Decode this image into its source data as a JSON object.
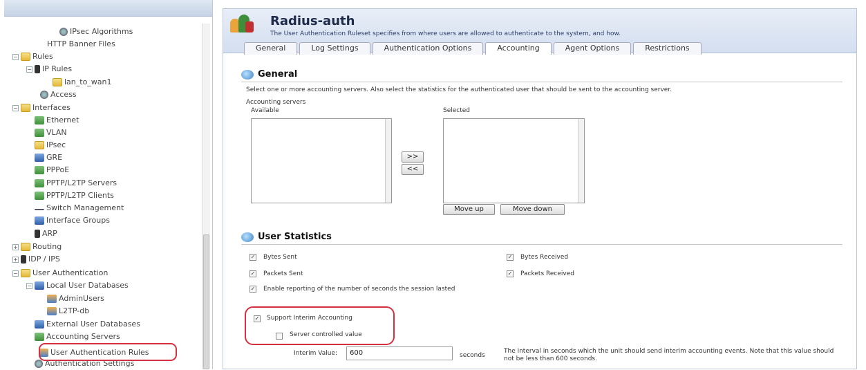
{
  "sidebar": {
    "items": [
      {
        "label": "IPsec Algorithms",
        "icon": "gear-icon"
      },
      {
        "label": "HTTP Banner Files",
        "icon": ""
      },
      {
        "label": "Rules",
        "icon": "folder-icon",
        "expander": "⊟"
      },
      {
        "label": "IP Rules",
        "icon": "rules-icon",
        "expander": "⊟"
      },
      {
        "label": "lan_to_wan1",
        "icon": "rule-icon"
      },
      {
        "label": "Access",
        "icon": "access-icon"
      },
      {
        "label": "Interfaces",
        "icon": "folder-icon",
        "expander": "⊟"
      },
      {
        "label": "Ethernet",
        "icon": "ethernet-icon"
      },
      {
        "label": "VLAN",
        "icon": "vlan-icon"
      },
      {
        "label": "IPsec",
        "icon": "ipsec-icon"
      },
      {
        "label": "GRE",
        "icon": "gre-icon"
      },
      {
        "label": "PPPoE",
        "icon": "pppoe-icon"
      },
      {
        "label": "PPTP/L2TP Servers",
        "icon": "server-icon"
      },
      {
        "label": "PPTP/L2TP Clients",
        "icon": "client-icon"
      },
      {
        "label": "Switch Management",
        "icon": "switch-icon"
      },
      {
        "label": "Interface Groups",
        "icon": "group-icon"
      },
      {
        "label": "ARP",
        "icon": "arp-icon"
      },
      {
        "label": "Routing",
        "icon": "folder-icon",
        "expander": "⊞"
      },
      {
        "label": "IDP / IPS",
        "icon": "idp-icon",
        "expander": "⊞"
      },
      {
        "label": "User Authentication",
        "icon": "folder-icon",
        "expander": "⊟"
      },
      {
        "label": "Local User Databases",
        "icon": "database-icon",
        "expander": "⊟"
      },
      {
        "label": "AdminUsers",
        "icon": "users-icon"
      },
      {
        "label": "L2TP-db",
        "icon": "users-icon"
      },
      {
        "label": "External User Databases",
        "icon": "database-icon"
      },
      {
        "label": "Accounting Servers",
        "icon": "server-icon"
      },
      {
        "label": "User Authentication Rules",
        "icon": "user-auth-icon"
      },
      {
        "label": "Authentication Settings",
        "icon": "settings-icon"
      }
    ]
  },
  "header": {
    "title": "Radius-auth",
    "description": "The User Authentication Ruleset specifies from where users are allowed to authenticate to the system, and how."
  },
  "tabs": [
    {
      "label": "General"
    },
    {
      "label": "Log Settings"
    },
    {
      "label": "Authentication Options"
    },
    {
      "label": "Accounting",
      "active": true
    },
    {
      "label": "Agent Options"
    },
    {
      "label": "Restrictions"
    }
  ],
  "general": {
    "title": "General",
    "description": "Select one or more accounting servers. Also select the statistics for the authenticated user that should be sent to the accounting server.",
    "accounting_servers_label": "Accounting servers",
    "available_label": "Available",
    "selected_label": "Selected",
    "add_label": ">>",
    "remove_label": "<<",
    "move_up_label": "Move up",
    "move_down_label": "Move down"
  },
  "user_statistics": {
    "title": "User Statistics",
    "bytes_sent": "Bytes Sent",
    "bytes_received": "Bytes Received",
    "packets_sent": "Packets Sent",
    "packets_received": "Packets Received",
    "enable_reporting": "Enable reporting of the number of seconds the session lasted",
    "support_interim": "Support Interim Accounting",
    "server_controlled": "Server controlled value",
    "interim_label": "Interim Value:",
    "interim_value": "600",
    "seconds": "seconds",
    "interim_help": "The interval in seconds which the unit should send interim accounting events. Note that this value should not be less than 600 seconds.",
    "checks": {
      "bytes_sent": true,
      "bytes_received": true,
      "packets_sent": true,
      "packets_received": true,
      "enable_reporting": true,
      "support_interim": true,
      "server_controlled": false
    }
  },
  "colors": {
    "highlight": "#d43040",
    "header_bg": "#d3def0",
    "title": "#1d2b48"
  }
}
